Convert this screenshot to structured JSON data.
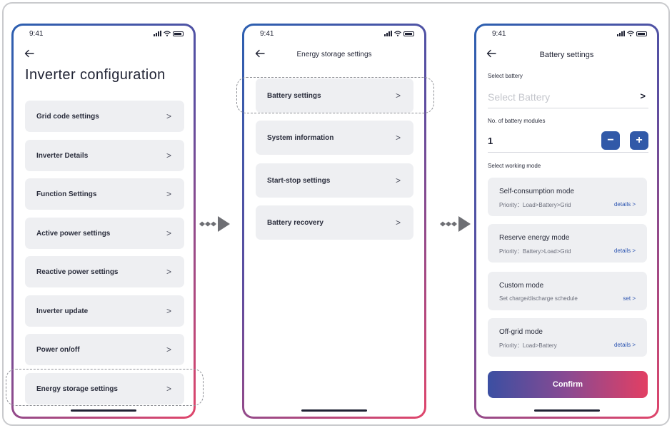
{
  "status": {
    "time": "9:41"
  },
  "screen1": {
    "title": "Inverter configuration",
    "items": [
      {
        "label": "Grid code settings"
      },
      {
        "label": "Inverter Details"
      },
      {
        "label": "Function Settings"
      },
      {
        "label": "Active power settings"
      },
      {
        "label": "Reactive power settings"
      },
      {
        "label": "Inverter update"
      },
      {
        "label": "Power on/off"
      },
      {
        "label": "Energy storage settings"
      }
    ]
  },
  "screen2": {
    "title": "Energy storage settings",
    "items": [
      {
        "label": "Battery settings"
      },
      {
        "label": "System information"
      },
      {
        "label": "Start-stop settings"
      },
      {
        "label": "Battery recovery"
      }
    ]
  },
  "screen3": {
    "title": "Battery settings",
    "select_battery_label": "Select battery",
    "select_battery_placeholder": "Select Battery",
    "modules_label": "No. of battery modules",
    "modules_value": "1",
    "minus": "−",
    "plus": "+",
    "working_mode_label": "Select working mode",
    "modes": [
      {
        "name": "Self-consumption mode",
        "sub": "Priority：Load>Battery>Grid",
        "link": "details >"
      },
      {
        "name": "Reserve energy mode",
        "sub": "Priority：Battery>Load>Grid",
        "link": "details >"
      },
      {
        "name": "Custom mode",
        "sub": "Set charge/discharge schedule",
        "link": "set >"
      },
      {
        "name": "Off-grid mode",
        "sub": "Priority：Load>Battery",
        "link": "details >"
      }
    ],
    "confirm_label": "Confirm"
  },
  "chevron": ">",
  "icons": {
    "back": "arrow-left-icon",
    "signal": "signal-icon",
    "wifi": "wifi-icon",
    "battery": "battery-icon",
    "flow": "flow-arrow-icon"
  },
  "colors": {
    "accent_blue": "#3159a8",
    "gradient_start": "#2c5fb0",
    "gradient_end": "#e0466b",
    "link_blue": "#2d55b1",
    "card_bg": "#eeeff2"
  }
}
